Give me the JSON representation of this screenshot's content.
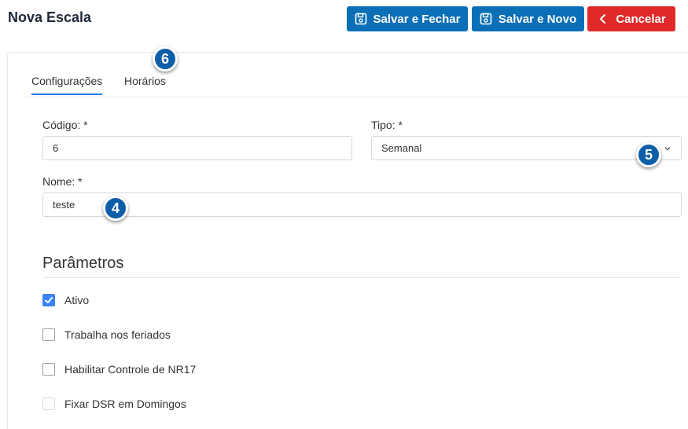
{
  "header": {
    "title": "Nova Escala",
    "buttons": {
      "save_close": "Salvar e Fechar",
      "save_new": "Salvar e Novo",
      "cancel": "Cancelar"
    }
  },
  "tabs": [
    {
      "label": "Configurações",
      "active": true
    },
    {
      "label": "Horários",
      "active": false
    }
  ],
  "form": {
    "codigo": {
      "label": "Código: *",
      "value": "6"
    },
    "tipo": {
      "label": "Tipo: *",
      "value": "Semanal"
    },
    "nome": {
      "label": "Nome: *",
      "value": "teste"
    }
  },
  "parametros": {
    "title": "Parâmetros",
    "options": [
      {
        "label": "Ativo",
        "checked": true
      },
      {
        "label": "Trabalha nos feriados",
        "checked": false
      },
      {
        "label": "Habilitar Controle de NR17",
        "checked": false
      },
      {
        "label": "Fixar DSR em Domingos",
        "checked": false
      }
    ]
  },
  "markers": {
    "m4": "4",
    "m5": "5",
    "m6": "6"
  },
  "colors": {
    "primary": "#0a6fb6",
    "danger": "#e02a2a",
    "accent": "#3b82f6",
    "marker": "#0d5ea8"
  }
}
